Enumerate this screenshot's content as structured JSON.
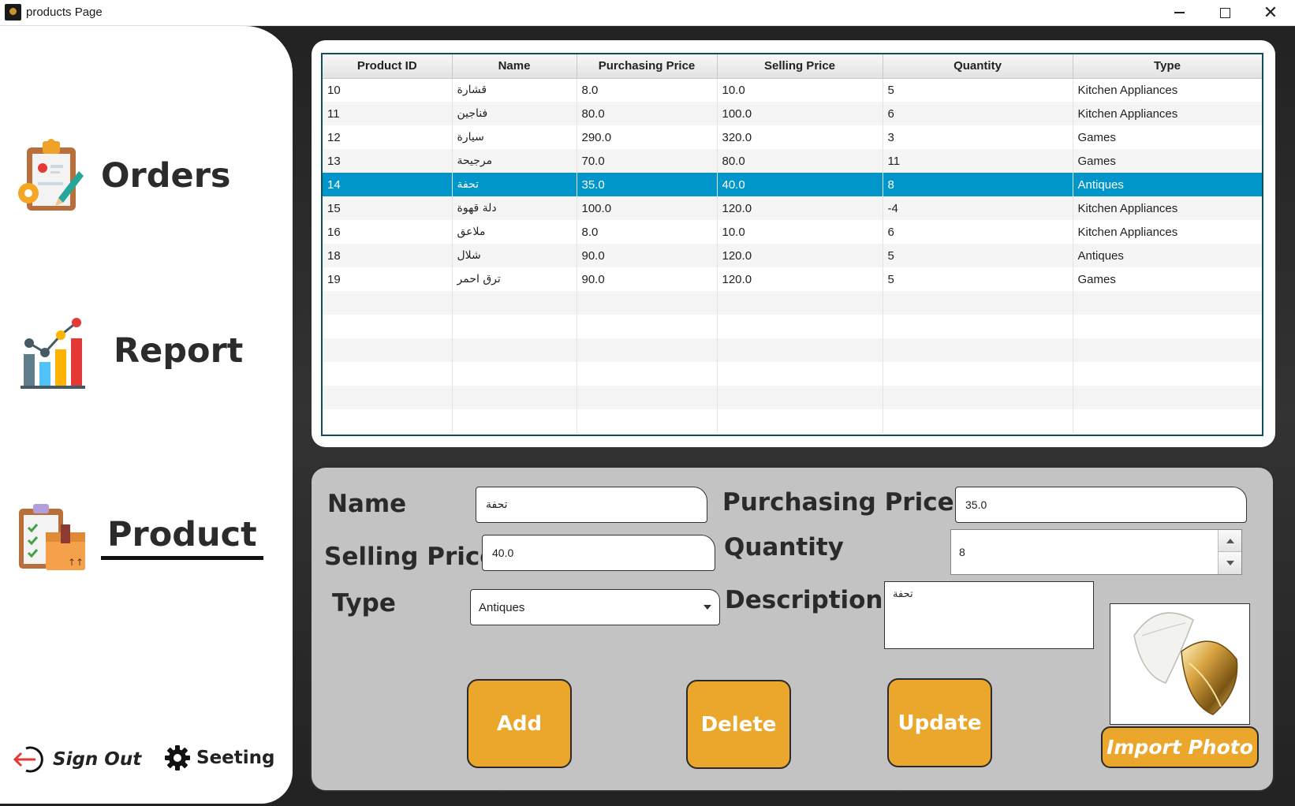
{
  "window": {
    "title": "products Page",
    "minimize": "",
    "maximize": "",
    "close": "✕"
  },
  "sidebar": {
    "orders_label": "Orders",
    "report_label": "Report",
    "product_label": "Product",
    "active": "Product",
    "signout_label": "Sign Out",
    "setting_label": "Seeting"
  },
  "table": {
    "headers": [
      "Product ID",
      "Name",
      "Purchasing Price",
      "Selling Price",
      "Quantity",
      "Type"
    ],
    "rows": [
      {
        "id": "10",
        "name": "قشارة",
        "purchasing": "8.0",
        "selling": "10.0",
        "quantity": "5",
        "type": "Kitchen Appliances"
      },
      {
        "id": "11",
        "name": "فناجين",
        "purchasing": "80.0",
        "selling": "100.0",
        "quantity": "6",
        "type": "Kitchen Appliances"
      },
      {
        "id": "12",
        "name": "سيارة",
        "purchasing": "290.0",
        "selling": "320.0",
        "quantity": "3",
        "type": "Games"
      },
      {
        "id": "13",
        "name": "مرجيحة",
        "purchasing": "70.0",
        "selling": "80.0",
        "quantity": "11",
        "type": "Games"
      },
      {
        "id": "14",
        "name": "تحفة",
        "purchasing": "35.0",
        "selling": "40.0",
        "quantity": "8",
        "type": "Antiques"
      },
      {
        "id": "15",
        "name": "دلة قهوة",
        "purchasing": "100.0",
        "selling": "120.0",
        "quantity": "-4",
        "type": "Kitchen Appliances"
      },
      {
        "id": "16",
        "name": "ملاعق",
        "purchasing": "8.0",
        "selling": "10.0",
        "quantity": "6",
        "type": "Kitchen Appliances"
      },
      {
        "id": "18",
        "name": "شلال",
        "purchasing": "90.0",
        "selling": "120.0",
        "quantity": "5",
        "type": "Antiques"
      },
      {
        "id": "19",
        "name": "ترق احمر",
        "purchasing": "90.0",
        "selling": "120.0",
        "quantity": "5",
        "type": "Games"
      }
    ],
    "selected_row": 4
  },
  "form": {
    "name_label": "Name",
    "name_value": "تحفة",
    "purchasing_label": "Purchasing Price",
    "purchasing_value": "35.0",
    "selling_label": "Selling Price",
    "selling_value": "40.0",
    "quantity_label": "Quantity",
    "quantity_value": "8",
    "type_label": "Type",
    "type_value": "Antiques",
    "description_label": "Description",
    "description_value": "تحفة",
    "add_label": "Add",
    "delete_label": "Delete",
    "update_label": "Update",
    "import_label": "Import Photo"
  },
  "colors": {
    "accent": "#eba72b",
    "selection": "#0096c9",
    "panel_gray": "#c3c3c3"
  }
}
